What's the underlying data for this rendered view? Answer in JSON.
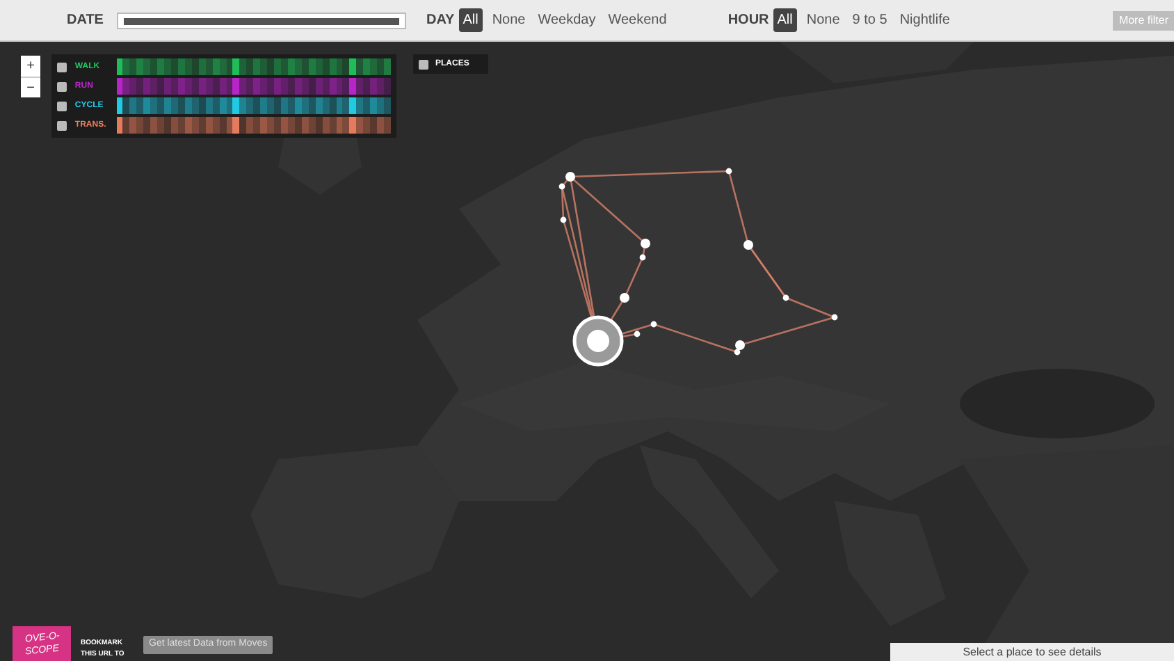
{
  "filter_bar": {
    "date": {
      "label": "DATE",
      "level": 1
    },
    "day": {
      "label": "DAY",
      "options": [
        {
          "label": "All",
          "selected": true
        },
        {
          "label": "None",
          "selected": false
        },
        {
          "label": "Weekday",
          "selected": false
        },
        {
          "label": "Weekend",
          "selected": false
        }
      ]
    },
    "hour": {
      "label": "HOUR",
      "options": [
        {
          "label": "All",
          "selected": true
        },
        {
          "label": "None",
          "selected": false
        },
        {
          "label": "9 to 5",
          "selected": false
        },
        {
          "label": "Nightlife",
          "selected": false
        }
      ]
    },
    "more_button": "More filter"
  },
  "zoom_controls": [
    "+",
    "−"
  ],
  "activities": [
    {
      "label": "WALK",
      "checked": true,
      "color": "#22c55e"
    },
    {
      "label": "RUN",
      "checked": true,
      "color": "#c026d3"
    },
    {
      "label": "CYCLE",
      "checked": true,
      "color": "#22d3ee"
    },
    {
      "label": "TRANS.",
      "checked": true,
      "color": "#f08060"
    }
  ],
  "places": {
    "label": "PLACES",
    "checked": true
  },
  "footer": {
    "logo": [
      "OVE-O-",
      "SCOPE"
    ],
    "bookmark": [
      "BOOKMARK",
      "THIS URL TO"
    ],
    "button": "Get latest Data from Moves",
    "details_panel": "Select a place to see details"
  }
}
